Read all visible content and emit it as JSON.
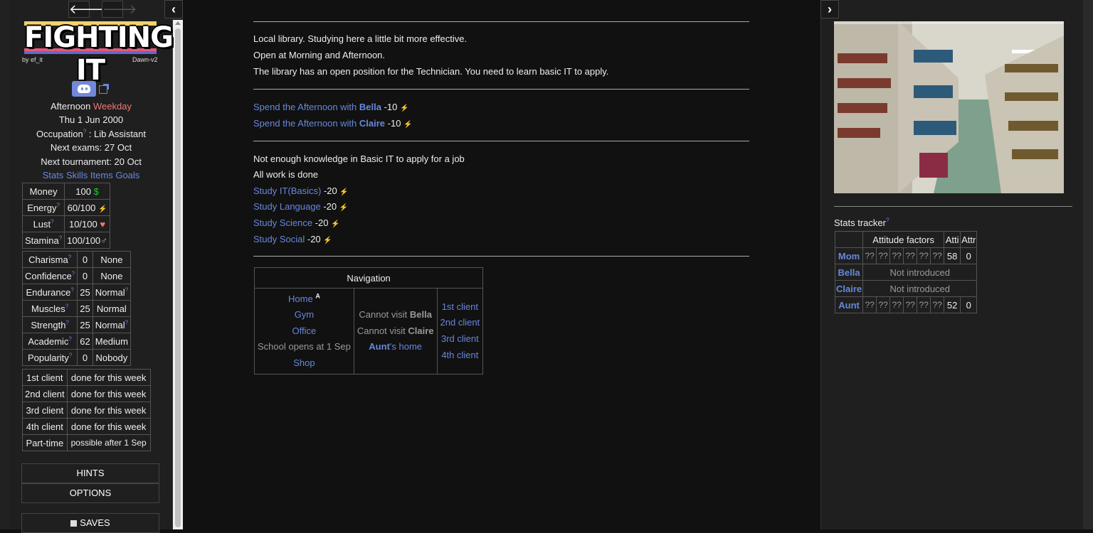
{
  "history": {
    "back_icon": "arrow-left-icon",
    "forward_icon": "arrow-right-icon"
  },
  "game": {
    "logo_text": "FIGHTING IT",
    "byline": "by ef_it",
    "version": "Dawn-v2"
  },
  "status": {
    "time": "Afternoon",
    "day_type": "Weekday",
    "date": "Thu 1 Jun 2000",
    "occupation_label": "Occupation",
    "occupation_value": " : Lib Assistant",
    "next_exams": "Next exams: 27 Oct",
    "next_tournament": "Next tournament: 20 Oct",
    "tabs": [
      "Stats",
      "Skills",
      "Items",
      "Goals"
    ]
  },
  "resources": [
    {
      "label": "Money",
      "value": "100",
      "icon": "$"
    },
    {
      "label": "Energy",
      "value": "60/100",
      "icon": "⚡"
    },
    {
      "label": "Lust",
      "value": "10/100",
      "icon": "♥"
    },
    {
      "label": "Stamina",
      "value": "100/100",
      "icon": "♂"
    }
  ],
  "stats": [
    {
      "label": "Charisma",
      "value": "0",
      "level": "None"
    },
    {
      "label": "Confidence",
      "value": "0",
      "level": "None"
    },
    {
      "label": "Endurance",
      "value": "25",
      "level": "Normal"
    },
    {
      "label": "Muscles",
      "value": "25",
      "level": "Normal"
    },
    {
      "label": "Strength",
      "value": "25",
      "level": "Normal"
    },
    {
      "label": "Academic",
      "value": "62",
      "level": "Medium"
    },
    {
      "label": "Popularity",
      "value": "0",
      "level": "Nobody"
    }
  ],
  "clients": [
    {
      "label": "1st client",
      "status": "done for this week"
    },
    {
      "label": "2nd client",
      "status": "done for this week"
    },
    {
      "label": "3rd client",
      "status": "done for this week"
    },
    {
      "label": "4th client",
      "status": "done for this week"
    },
    {
      "label": "Part-time",
      "status": "possible after 1 Sep"
    }
  ],
  "menu": {
    "hints": "HINTS",
    "options": "OPTIONS",
    "saves": "SAVES"
  },
  "main": {
    "description": [
      "Local library. Studying here a little bit more effective.",
      "Open at Morning and Afternoon.",
      "The library has an open position for the Technician. You need to learn basic IT to apply."
    ],
    "social": [
      {
        "prefix": "Spend the Afternoon with ",
        "name": "Bella",
        "cost": " -10"
      },
      {
        "prefix": "Spend the Afternoon with ",
        "name": "Claire",
        "cost": " -10"
      }
    ],
    "notices": [
      "Not enough knowledge in Basic IT to apply for a job",
      "All work is done"
    ],
    "study": [
      {
        "label": "Study IT(Basics)",
        "cost": " -20"
      },
      {
        "label": "Study Language",
        "cost": " -20"
      },
      {
        "label": "Study Science",
        "cost": " -20"
      },
      {
        "label": "Study Social",
        "cost": " -20"
      }
    ]
  },
  "navigation": {
    "title": "Navigation",
    "places": [
      "Home",
      "Gym",
      "Office",
      "School opens at 1 Sep",
      "Shop"
    ],
    "home_badge": "A",
    "cannot": [
      {
        "text": "Cannot visit ",
        "name": "Bella"
      },
      {
        "text": "Cannot visit ",
        "name": "Claire"
      }
    ],
    "aunt_name": "Aunt",
    "aunt_suffix": "'s home",
    "clients": [
      "1st client",
      "2nd client",
      "3rd client",
      "4th client"
    ]
  },
  "tracker": {
    "title": "Stats tracker",
    "headers": [
      "Attitude factors",
      "Atti",
      "Attr"
    ],
    "rows": [
      {
        "name": "Mom",
        "factors": [
          "??",
          "??",
          "??",
          "??",
          "??",
          "??"
        ],
        "atti": "58",
        "attr": "0"
      },
      {
        "name": "Bella",
        "status": "Not introduced"
      },
      {
        "name": "Claire",
        "status": "Not introduced"
      },
      {
        "name": "Aunt",
        "factors": [
          "??",
          "??",
          "??",
          "??",
          "??",
          "??"
        ],
        "atti": "52",
        "attr": "0"
      }
    ]
  },
  "help_mark": "?"
}
